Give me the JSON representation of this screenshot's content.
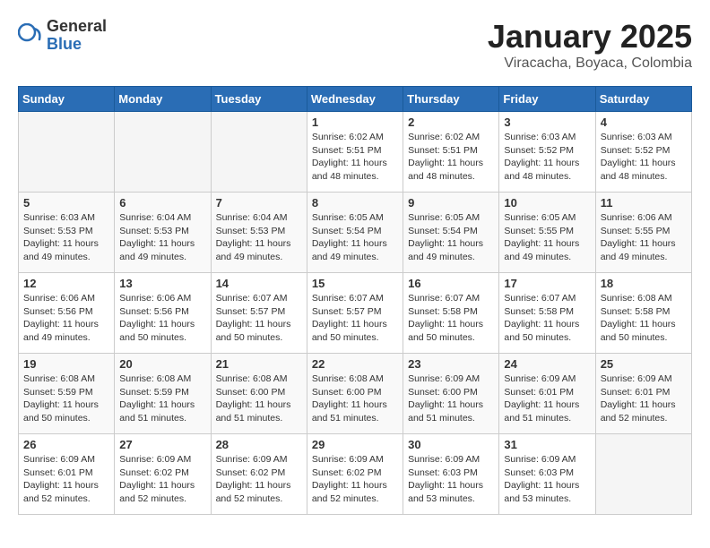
{
  "header": {
    "logo_general": "General",
    "logo_blue": "Blue",
    "month": "January 2025",
    "location": "Viracacha, Boyaca, Colombia"
  },
  "weekdays": [
    "Sunday",
    "Monday",
    "Tuesday",
    "Wednesday",
    "Thursday",
    "Friday",
    "Saturday"
  ],
  "weeks": [
    [
      {
        "num": "",
        "info": ""
      },
      {
        "num": "",
        "info": ""
      },
      {
        "num": "",
        "info": ""
      },
      {
        "num": "1",
        "info": "Sunrise: 6:02 AM\nSunset: 5:51 PM\nDaylight: 11 hours and 48 minutes."
      },
      {
        "num": "2",
        "info": "Sunrise: 6:02 AM\nSunset: 5:51 PM\nDaylight: 11 hours and 48 minutes."
      },
      {
        "num": "3",
        "info": "Sunrise: 6:03 AM\nSunset: 5:52 PM\nDaylight: 11 hours and 48 minutes."
      },
      {
        "num": "4",
        "info": "Sunrise: 6:03 AM\nSunset: 5:52 PM\nDaylight: 11 hours and 48 minutes."
      }
    ],
    [
      {
        "num": "5",
        "info": "Sunrise: 6:03 AM\nSunset: 5:53 PM\nDaylight: 11 hours and 49 minutes."
      },
      {
        "num": "6",
        "info": "Sunrise: 6:04 AM\nSunset: 5:53 PM\nDaylight: 11 hours and 49 minutes."
      },
      {
        "num": "7",
        "info": "Sunrise: 6:04 AM\nSunset: 5:53 PM\nDaylight: 11 hours and 49 minutes."
      },
      {
        "num": "8",
        "info": "Sunrise: 6:05 AM\nSunset: 5:54 PM\nDaylight: 11 hours and 49 minutes."
      },
      {
        "num": "9",
        "info": "Sunrise: 6:05 AM\nSunset: 5:54 PM\nDaylight: 11 hours and 49 minutes."
      },
      {
        "num": "10",
        "info": "Sunrise: 6:05 AM\nSunset: 5:55 PM\nDaylight: 11 hours and 49 minutes."
      },
      {
        "num": "11",
        "info": "Sunrise: 6:06 AM\nSunset: 5:55 PM\nDaylight: 11 hours and 49 minutes."
      }
    ],
    [
      {
        "num": "12",
        "info": "Sunrise: 6:06 AM\nSunset: 5:56 PM\nDaylight: 11 hours and 49 minutes."
      },
      {
        "num": "13",
        "info": "Sunrise: 6:06 AM\nSunset: 5:56 PM\nDaylight: 11 hours and 50 minutes."
      },
      {
        "num": "14",
        "info": "Sunrise: 6:07 AM\nSunset: 5:57 PM\nDaylight: 11 hours and 50 minutes."
      },
      {
        "num": "15",
        "info": "Sunrise: 6:07 AM\nSunset: 5:57 PM\nDaylight: 11 hours and 50 minutes."
      },
      {
        "num": "16",
        "info": "Sunrise: 6:07 AM\nSunset: 5:58 PM\nDaylight: 11 hours and 50 minutes."
      },
      {
        "num": "17",
        "info": "Sunrise: 6:07 AM\nSunset: 5:58 PM\nDaylight: 11 hours and 50 minutes."
      },
      {
        "num": "18",
        "info": "Sunrise: 6:08 AM\nSunset: 5:58 PM\nDaylight: 11 hours and 50 minutes."
      }
    ],
    [
      {
        "num": "19",
        "info": "Sunrise: 6:08 AM\nSunset: 5:59 PM\nDaylight: 11 hours and 50 minutes."
      },
      {
        "num": "20",
        "info": "Sunrise: 6:08 AM\nSunset: 5:59 PM\nDaylight: 11 hours and 51 minutes."
      },
      {
        "num": "21",
        "info": "Sunrise: 6:08 AM\nSunset: 6:00 PM\nDaylight: 11 hours and 51 minutes."
      },
      {
        "num": "22",
        "info": "Sunrise: 6:08 AM\nSunset: 6:00 PM\nDaylight: 11 hours and 51 minutes."
      },
      {
        "num": "23",
        "info": "Sunrise: 6:09 AM\nSunset: 6:00 PM\nDaylight: 11 hours and 51 minutes."
      },
      {
        "num": "24",
        "info": "Sunrise: 6:09 AM\nSunset: 6:01 PM\nDaylight: 11 hours and 51 minutes."
      },
      {
        "num": "25",
        "info": "Sunrise: 6:09 AM\nSunset: 6:01 PM\nDaylight: 11 hours and 52 minutes."
      }
    ],
    [
      {
        "num": "26",
        "info": "Sunrise: 6:09 AM\nSunset: 6:01 PM\nDaylight: 11 hours and 52 minutes."
      },
      {
        "num": "27",
        "info": "Sunrise: 6:09 AM\nSunset: 6:02 PM\nDaylight: 11 hours and 52 minutes."
      },
      {
        "num": "28",
        "info": "Sunrise: 6:09 AM\nSunset: 6:02 PM\nDaylight: 11 hours and 52 minutes."
      },
      {
        "num": "29",
        "info": "Sunrise: 6:09 AM\nSunset: 6:02 PM\nDaylight: 11 hours and 52 minutes."
      },
      {
        "num": "30",
        "info": "Sunrise: 6:09 AM\nSunset: 6:03 PM\nDaylight: 11 hours and 53 minutes."
      },
      {
        "num": "31",
        "info": "Sunrise: 6:09 AM\nSunset: 6:03 PM\nDaylight: 11 hours and 53 minutes."
      },
      {
        "num": "",
        "info": ""
      }
    ]
  ]
}
